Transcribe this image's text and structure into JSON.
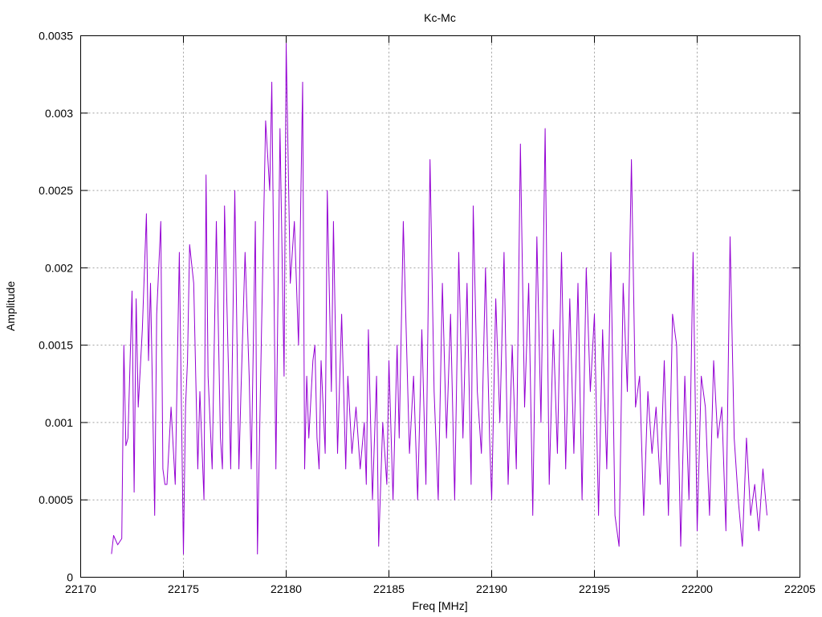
{
  "chart_data": {
    "type": "line",
    "title": "Kc-Mc",
    "xlabel": "Freq [MHz]",
    "ylabel": "Amplitude",
    "xlim": [
      22170,
      22205
    ],
    "ylim": [
      0,
      0.0035
    ],
    "x_ticks": [
      "22170",
      "22175",
      "22180",
      "22185",
      "22190",
      "22195",
      "22200",
      "22205"
    ],
    "y_ticks": [
      "0",
      "0.0005",
      "0.001",
      "0.0015",
      "0.002",
      "0.0025",
      "0.003",
      "0.0035"
    ],
    "grid": true,
    "line_color": "#9400d3",
    "series": [
      {
        "x": [
          22171.5,
          22171.6,
          22171.8,
          22172.0,
          22172.1,
          22172.2,
          22172.3,
          22172.5,
          22172.6,
          22172.7,
          22172.8,
          22173.0,
          22173.2,
          22173.3,
          22173.4,
          22173.6,
          22173.7,
          22173.9,
          22174.0,
          22174.1,
          22174.2,
          22174.4,
          22174.6,
          22174.8,
          22175.0,
          22175.1,
          22175.2,
          22175.3,
          22175.5,
          22175.7,
          22175.8,
          22176.0,
          22176.1,
          22176.2,
          22176.4,
          22176.6,
          22176.8,
          22176.9,
          22177.0,
          22177.2,
          22177.3,
          22177.5,
          22177.7,
          22177.8,
          22178.0,
          22178.2,
          22178.3,
          22178.5,
          22178.6,
          22178.8,
          22179.0,
          22179.2,
          22179.3,
          22179.5,
          22179.7,
          22179.9,
          22180.0,
          22180.2,
          22180.4,
          22180.6,
          22180.8,
          22180.9,
          22181.0,
          22181.1,
          22181.3,
          22181.4,
          22181.5,
          22181.6,
          22181.7,
          22181.9,
          22182.0,
          22182.2,
          22182.3,
          22182.5,
          22182.7,
          22182.9,
          22183.0,
          22183.2,
          22183.4,
          22183.6,
          22183.8,
          22183.9,
          22184.0,
          22184.2,
          22184.4,
          22184.5,
          22184.7,
          22184.9,
          22185.0,
          22185.2,
          22185.4,
          22185.5,
          22185.7,
          22185.9,
          22186.0,
          22186.2,
          22186.4,
          22186.6,
          22186.8,
          22187.0,
          22187.2,
          22187.4,
          22187.6,
          22187.8,
          22188.0,
          22188.2,
          22188.4,
          22188.6,
          22188.8,
          22189.0,
          22189.1,
          22189.3,
          22189.5,
          22189.7,
          22189.9,
          22190.0,
          22190.2,
          22190.4,
          22190.6,
          22190.8,
          22191.0,
          22191.2,
          22191.4,
          22191.6,
          22191.8,
          22192.0,
          22192.2,
          22192.4,
          22192.6,
          22192.8,
          22193.0,
          22193.2,
          22193.4,
          22193.6,
          22193.8,
          22194.0,
          22194.2,
          22194.4,
          22194.6,
          22194.8,
          22195.0,
          22195.2,
          22195.4,
          22195.6,
          22195.8,
          22196.0,
          22196.2,
          22196.4,
          22196.6,
          22196.8,
          22197.0,
          22197.2,
          22197.4,
          22197.6,
          22197.8,
          22198.0,
          22198.2,
          22198.4,
          22198.6,
          22198.8,
          22199.0,
          22199.2,
          22199.4,
          22199.6,
          22199.8,
          22200.0,
          22200.2,
          22200.4,
          22200.6,
          22200.8,
          22201.0,
          22201.2,
          22201.4,
          22201.6,
          22201.8,
          22202.0,
          22202.2,
          22202.4,
          22202.6,
          22202.8,
          22203.0,
          22203.2,
          22203.4
        ],
        "y": [
          0.00015,
          0.00027,
          0.00021,
          0.00025,
          0.0015,
          0.00085,
          0.0009,
          0.00185,
          0.00055,
          0.0018,
          0.0011,
          0.0016,
          0.00235,
          0.0014,
          0.0019,
          0.0004,
          0.0017,
          0.0023,
          0.0007,
          0.0006,
          0.0006,
          0.0011,
          0.0006,
          0.0021,
          0.00015,
          0.0011,
          0.0014,
          0.00215,
          0.0019,
          0.0007,
          0.0012,
          0.0005,
          0.0026,
          0.0013,
          0.0007,
          0.0023,
          0.0009,
          0.0007,
          0.0024,
          0.0013,
          0.0007,
          0.0025,
          0.0007,
          0.0012,
          0.0021,
          0.0013,
          0.0007,
          0.0023,
          0.00015,
          0.0016,
          0.00295,
          0.0025,
          0.0032,
          0.0007,
          0.0029,
          0.0013,
          0.00345,
          0.0019,
          0.0023,
          0.0015,
          0.0032,
          0.0007,
          0.0013,
          0.0009,
          0.0014,
          0.0015,
          0.0009,
          0.0007,
          0.0014,
          0.0008,
          0.0025,
          0.0012,
          0.0023,
          0.0008,
          0.0017,
          0.0007,
          0.0013,
          0.0008,
          0.0011,
          0.0007,
          0.001,
          0.0006,
          0.0016,
          0.0005,
          0.0013,
          0.0002,
          0.001,
          0.0006,
          0.0014,
          0.0005,
          0.0015,
          0.0009,
          0.0023,
          0.0013,
          0.0008,
          0.0013,
          0.0005,
          0.0016,
          0.0006,
          0.0027,
          0.0012,
          0.0005,
          0.0019,
          0.0009,
          0.0017,
          0.0005,
          0.0021,
          0.0009,
          0.0019,
          0.0006,
          0.0024,
          0.0012,
          0.0008,
          0.002,
          0.0009,
          0.0005,
          0.0018,
          0.001,
          0.0021,
          0.0006,
          0.0015,
          0.0007,
          0.0028,
          0.0011,
          0.0019,
          0.0004,
          0.0022,
          0.001,
          0.0029,
          0.0006,
          0.0016,
          0.0008,
          0.0021,
          0.0007,
          0.0018,
          0.0008,
          0.0019,
          0.0005,
          0.002,
          0.0012,
          0.0017,
          0.0004,
          0.0016,
          0.0007,
          0.0021,
          0.0004,
          0.0002,
          0.0019,
          0.0012,
          0.0027,
          0.0011,
          0.0013,
          0.0004,
          0.0012,
          0.0008,
          0.0011,
          0.0006,
          0.0014,
          0.0004,
          0.0017,
          0.0015,
          0.0002,
          0.0013,
          0.0005,
          0.0021,
          0.0003,
          0.0013,
          0.0011,
          0.0004,
          0.0014,
          0.0009,
          0.0011,
          0.0003,
          0.0022,
          0.0009,
          0.0005,
          0.0002,
          0.0009,
          0.0004,
          0.0006,
          0.0003,
          0.0007,
          0.0004
        ]
      }
    ]
  }
}
